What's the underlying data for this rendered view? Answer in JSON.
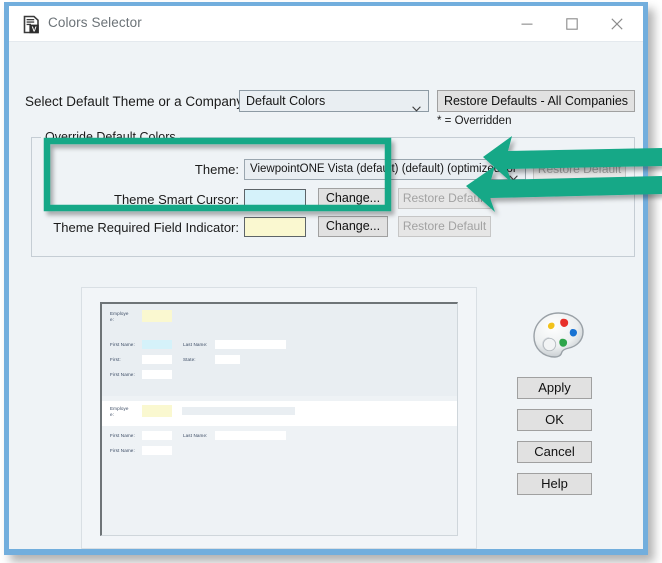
{
  "window": {
    "title": "Colors Selector",
    "app_icon": "document-v-badge-icon",
    "controls": {
      "minimize": "minimize-icon",
      "maximize": "maximize-icon",
      "close": "close-icon"
    },
    "border_color": "#72aedd",
    "body_color": "#eff3f6"
  },
  "top": {
    "select_label": "Select Default Theme or a Company:",
    "company_combo_value": "Default Colors",
    "restore_all_label": "Restore Defaults - All Companies",
    "overridden_note": "* = Overridden"
  },
  "override_group": {
    "title": "Override Default Colors",
    "rows": [
      {
        "label": "Theme:",
        "control_type": "combobox",
        "value": "ViewpointONE Vista (default) (default) (optimized for",
        "restore_label": "Restore Default",
        "restore_enabled": false
      },
      {
        "label": "Theme Smart Cursor:",
        "control_type": "color-swatch",
        "swatch_color": "#d5f2fa",
        "change_label": "Change...",
        "restore_label": "Restore Default",
        "restore_enabled": false
      },
      {
        "label": "Theme Required Field Indicator:",
        "control_type": "color-swatch",
        "swatch_color": "#faf8d0",
        "change_label": "Change...",
        "restore_label": "Restore Default",
        "restore_enabled": false
      }
    ]
  },
  "preview": {
    "sections": [
      {
        "header_label": "Employe\ne:",
        "header_style": "grey",
        "header_field_style": "required",
        "fields": [
          {
            "label": "First Name:",
            "style": "cursor"
          },
          {
            "label": "Last Name:",
            "style": "normal"
          },
          {
            "label": "First:",
            "style": "normal"
          },
          {
            "label": "State:",
            "style": "normal"
          },
          {
            "label": "First Name:",
            "style": "normal"
          }
        ]
      },
      {
        "header_label": "Employe\ne:",
        "header_style": "white",
        "header_field_style": "required",
        "fields": [
          {
            "label": "First Name:",
            "style": "normal"
          },
          {
            "label": "Last Name:",
            "style": "normal"
          },
          {
            "label": "First Name:",
            "style": "normal"
          }
        ]
      }
    ]
  },
  "side": {
    "palette_icon": "color-palette-icon",
    "buttons": [
      {
        "label": "Apply"
      },
      {
        "label": "OK"
      },
      {
        "label": "Cancel"
      },
      {
        "label": "Help"
      }
    ]
  },
  "annotations": {
    "highlight_color": "#13a887",
    "highlight_box": "teal-rectangle-around-cursor-and-required-rows",
    "arrows": [
      {
        "name": "arrow-to-restore-default-cursor",
        "points_to": "Restore Default"
      },
      {
        "name": "arrow-to-restore-default-required",
        "points_to": "Restore Default"
      }
    ]
  }
}
